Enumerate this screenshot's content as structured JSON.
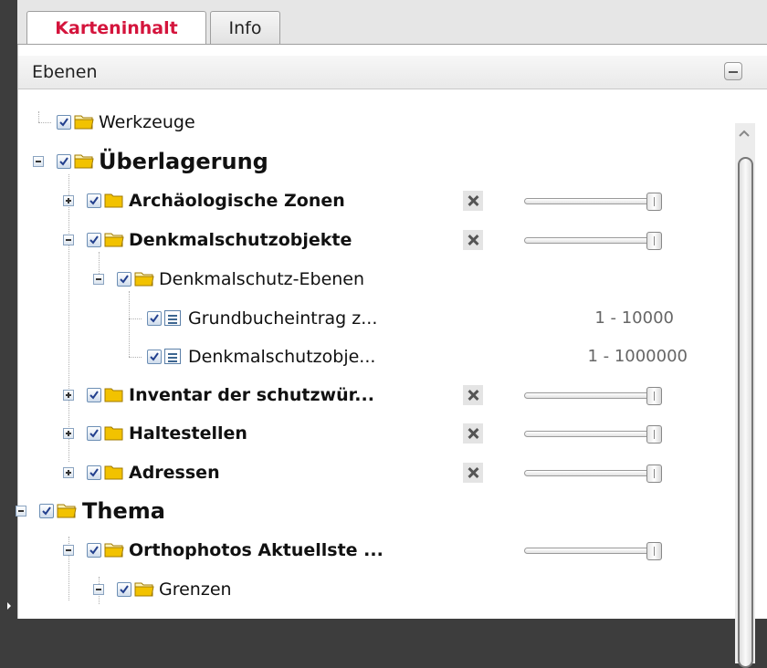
{
  "tabs": [
    {
      "label": "Karteninhalt",
      "active": true
    },
    {
      "label": "Info",
      "active": false
    }
  ],
  "section": {
    "title": "Ebenen"
  },
  "tree": [
    {
      "label": "Werkzeuge"
    },
    {
      "label": "Überlagerung"
    },
    {
      "label": "Archäologische Zonen"
    },
    {
      "label": "Denkmalschutzobjekte"
    },
    {
      "label": "Denkmalschutz-Ebenen"
    },
    {
      "label": "Grundbucheintrag z...",
      "scale": "1 - 10000"
    },
    {
      "label": "Denkmalschutzobje...",
      "scale": "1 - 1000000"
    },
    {
      "label": "Inventar der schutzwür..."
    },
    {
      "label": "Haltestellen"
    },
    {
      "label": "Adressen"
    },
    {
      "label": "Thema"
    },
    {
      "label": "Orthophotos Aktuellste ..."
    },
    {
      "label": "Grenzen"
    }
  ],
  "opacity_levels": [
    1.0,
    1.0,
    1.0,
    1.0,
    1.0,
    1.0
  ],
  "colors": {
    "active_tab_text": "#d4143c",
    "folder": "#f2c200",
    "checkbox_border": "#6d8fb5"
  },
  "icons": {
    "folder": "folder-icon",
    "layer": "layer-icon",
    "remove": "remove-icon",
    "collapse": "minus-icon"
  }
}
